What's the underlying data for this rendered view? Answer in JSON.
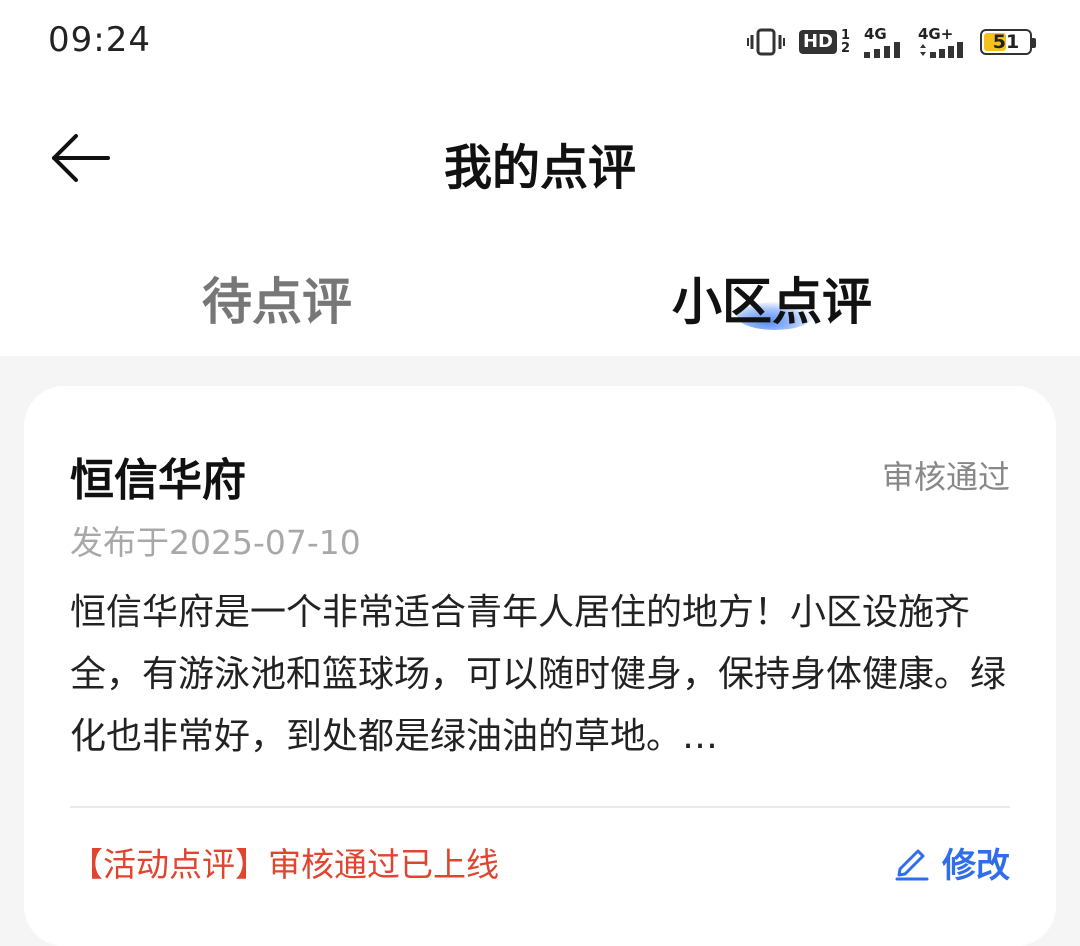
{
  "status_bar": {
    "time": "09:24",
    "hd_label": "HD",
    "sim_numbers": [
      "1",
      "2"
    ],
    "net1": "4G",
    "net2": "4G+",
    "battery": "51",
    "battery_level": 0.51,
    "battery_color": "#f6c11a",
    "icons": [
      "vibrate-icon",
      "hd-icon",
      "signal-icon",
      "battery-icon"
    ]
  },
  "header": {
    "title": "我的点评",
    "back_icon": "back-arrow-icon"
  },
  "tabs": [
    {
      "label": "待点评",
      "active": false
    },
    {
      "label": "小区点评",
      "active": true
    }
  ],
  "review": {
    "community": "恒信华府",
    "status": "审核通过",
    "date": "发布于2025-07-10",
    "content": "恒信华府是一个非常适合青年人居住的地方！小区设施齐全，有游泳池和篮球场，可以随时健身，保持身体健康。绿化也非常好，到处都是绿油油的草地。…",
    "activity_note": "【活动点评】审核通过已上线",
    "edit_label": "修改",
    "edit_icon": "pencil-icon"
  },
  "colors": {
    "accent": "#2f6ee8",
    "activity_red": "#e0452f",
    "muted": "#888888"
  }
}
